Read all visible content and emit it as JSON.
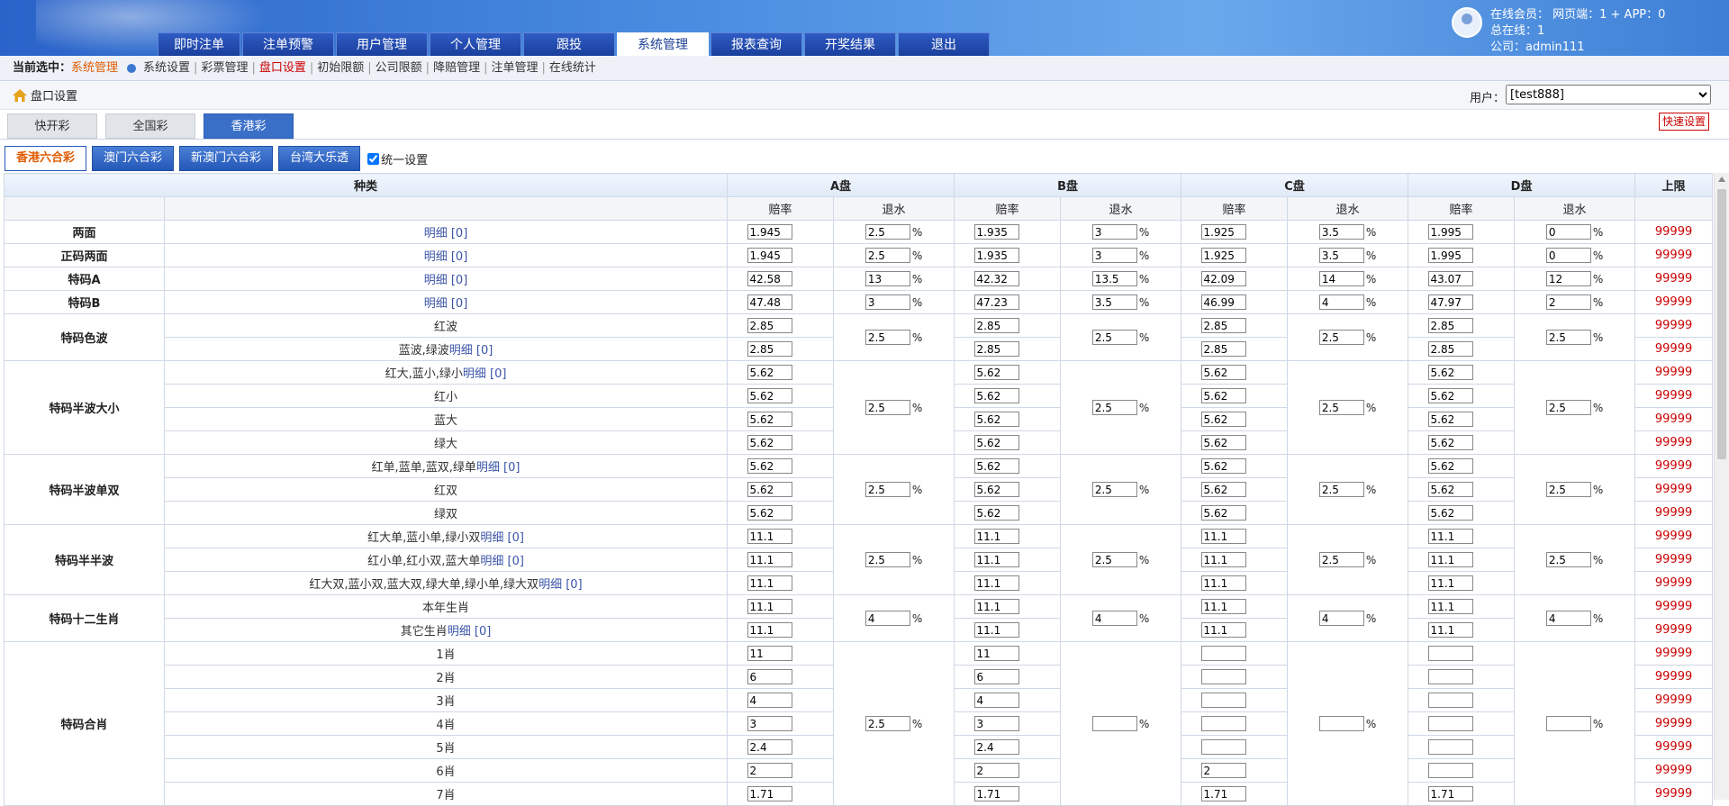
{
  "nav": [
    "即时注单",
    "注单预警",
    "用户管理",
    "个人管理",
    "跟投",
    "系统管理",
    "报表查询",
    "开奖结果",
    "退出"
  ],
  "nav_active": 5,
  "user": {
    "online": "在线会员： 网页端：1 + APP：0",
    "total": "总在线：1",
    "company": "公司：admin111"
  },
  "crumb": {
    "label": "当前选中：",
    "current": "系统管理",
    "links": [
      "系统设置",
      "彩票管理",
      "盘口设置",
      "初始限额",
      "公司限额",
      "降赔管理",
      "注单管理",
      "在线统计"
    ],
    "active_link": 2
  },
  "page": {
    "title": "盘口设置",
    "user_label": "用户：",
    "user_value": "[test888]",
    "quick_button": "快速设置"
  },
  "lottery_tabs": [
    "快开彩",
    "全国彩",
    "香港彩"
  ],
  "lottery_active": 2,
  "sub_tabs": [
    "香港六合彩",
    "澳门六合彩",
    "新澳门六合彩",
    "台湾大乐透"
  ],
  "sub_active": 0,
  "unified": "统一设置",
  "table": {
    "h_kind": "种类",
    "h_pans": [
      "A盘",
      "B盘",
      "C盘",
      "D盘"
    ],
    "h_limit": "上限",
    "h_odds": "赔率",
    "h_rebate": "退水",
    "pct": "%",
    "groups": [
      {
        "name": "两面",
        "rows": [
          {
            "label": "明细 [0]",
            "link": true,
            "odds": [
              "1.945",
              "1.935",
              "1.925",
              "1.995"
            ],
            "limit": "99999"
          }
        ],
        "rebates": [
          "2.5",
          "3",
          "3.5",
          "0"
        ]
      },
      {
        "name": "正码两面",
        "rows": [
          {
            "label": "明细 [0]",
            "link": true,
            "odds": [
              "1.945",
              "1.935",
              "1.925",
              "1.995"
            ],
            "limit": "99999"
          }
        ],
        "rebates": [
          "2.5",
          "3",
          "3.5",
          "0"
        ]
      },
      {
        "name": "特码A",
        "rows": [
          {
            "label": "明细 [0]",
            "link": true,
            "odds": [
              "42.58",
              "42.32",
              "42.09",
              "43.07"
            ],
            "limit": "99999"
          }
        ],
        "rebates": [
          "13",
          "13.5",
          "14",
          "12"
        ]
      },
      {
        "name": "特码B",
        "rows": [
          {
            "label": "明细 [0]",
            "link": true,
            "odds": [
              "47.48",
              "47.23",
              "46.99",
              "47.97"
            ],
            "limit": "99999"
          }
        ],
        "rebates": [
          "3",
          "3.5",
          "4",
          "2"
        ]
      },
      {
        "name": "特码色波",
        "rows": [
          {
            "label": "红波",
            "odds": [
              "2.85",
              "2.85",
              "2.85",
              "2.85"
            ],
            "limit": "99999"
          },
          {
            "label": "蓝波,绿波",
            "linktext": "明细 [0]",
            "odds": [
              "2.85",
              "2.85",
              "2.85",
              "2.85"
            ],
            "limit": "99999"
          }
        ],
        "rebates": [
          "2.5",
          "2.5",
          "2.5",
          "2.5"
        ]
      },
      {
        "name": "特码半波大小",
        "rows": [
          {
            "label": "红大,蓝小,绿小",
            "linktext": "明细 [0]",
            "odds": [
              "5.62",
              "5.62",
              "5.62",
              "5.62"
            ],
            "limit": "99999"
          },
          {
            "label": "红小",
            "odds": [
              "5.62",
              "5.62",
              "5.62",
              "5.62"
            ],
            "limit": "99999"
          },
          {
            "label": "蓝大",
            "odds": [
              "5.62",
              "5.62",
              "5.62",
              "5.62"
            ],
            "limit": "99999"
          },
          {
            "label": "绿大",
            "odds": [
              "5.62",
              "5.62",
              "5.62",
              "5.62"
            ],
            "limit": "99999"
          }
        ],
        "rebates": [
          "2.5",
          "2.5",
          "2.5",
          "2.5"
        ]
      },
      {
        "name": "特码半波单双",
        "rows": [
          {
            "label": "红单,蓝单,蓝双,绿单",
            "linktext": "明细 [0]",
            "odds": [
              "5.62",
              "5.62",
              "5.62",
              "5.62"
            ],
            "limit": "99999"
          },
          {
            "label": "红双",
            "odds": [
              "5.62",
              "5.62",
              "5.62",
              "5.62"
            ],
            "limit": "99999"
          },
          {
            "label": "绿双",
            "odds": [
              "5.62",
              "5.62",
              "5.62",
              "5.62"
            ],
            "limit": "99999"
          }
        ],
        "rebates": [
          "2.5",
          "2.5",
          "2.5",
          "2.5"
        ]
      },
      {
        "name": "特码半半波",
        "rows": [
          {
            "label": "红大单,蓝小单,绿小双",
            "linktext": "明细 [0]",
            "odds": [
              "11.1",
              "11.1",
              "11.1",
              "11.1"
            ],
            "limit": "99999"
          },
          {
            "label": "红小单,红小双,蓝大单",
            "linktext": "明细 [0]",
            "odds": [
              "11.1",
              "11.1",
              "11.1",
              "11.1"
            ],
            "limit": "99999"
          },
          {
            "label": "红大双,蓝小双,蓝大双,绿大单,绿小单,绿大双",
            "linktext": "明细 [0]",
            "odds": [
              "11.1",
              "11.1",
              "11.1",
              "11.1"
            ],
            "limit": "99999"
          }
        ],
        "rebates": [
          "2.5",
          "2.5",
          "2.5",
          "2.5"
        ]
      },
      {
        "name": "特码十二生肖",
        "rows": [
          {
            "label": "本年生肖",
            "odds": [
              "11.1",
              "11.1",
              "11.1",
              "11.1"
            ],
            "limit": "99999"
          },
          {
            "label": "其它生肖",
            "linktext": "明细 [0]",
            "odds": [
              "11.1",
              "11.1",
              "11.1",
              "11.1"
            ],
            "limit": "99999"
          }
        ],
        "rebates": [
          "4",
          "4",
          "4",
          "4"
        ]
      },
      {
        "name": "特码合肖",
        "rows": [
          {
            "label": "1肖",
            "odds": [
              "11",
              "11",
              "",
              ""
            ],
            "limit": "99999"
          },
          {
            "label": "2肖",
            "odds": [
              "6",
              "6",
              "",
              ""
            ],
            "limit": "99999"
          },
          {
            "label": "3肖",
            "odds": [
              "4",
              "4",
              "",
              ""
            ],
            "limit": "99999"
          },
          {
            "label": "4肖",
            "odds": [
              "3",
              "3",
              "",
              ""
            ],
            "limit": "99999"
          },
          {
            "label": "5肖",
            "odds": [
              "2.4",
              "2.4",
              "",
              ""
            ],
            "limit": "99999"
          },
          {
            "label": "6肖",
            "odds": [
              "2",
              "2",
              "2",
              ""
            ],
            "limit": "99999"
          },
          {
            "label": "7肖",
            "odds": [
              "1.71",
              "1.71",
              "1.71",
              "1.71"
            ],
            "limit": "99999"
          }
        ],
        "rebates": [
          "2.5",
          "",
          "",
          ""
        ]
      }
    ]
  }
}
